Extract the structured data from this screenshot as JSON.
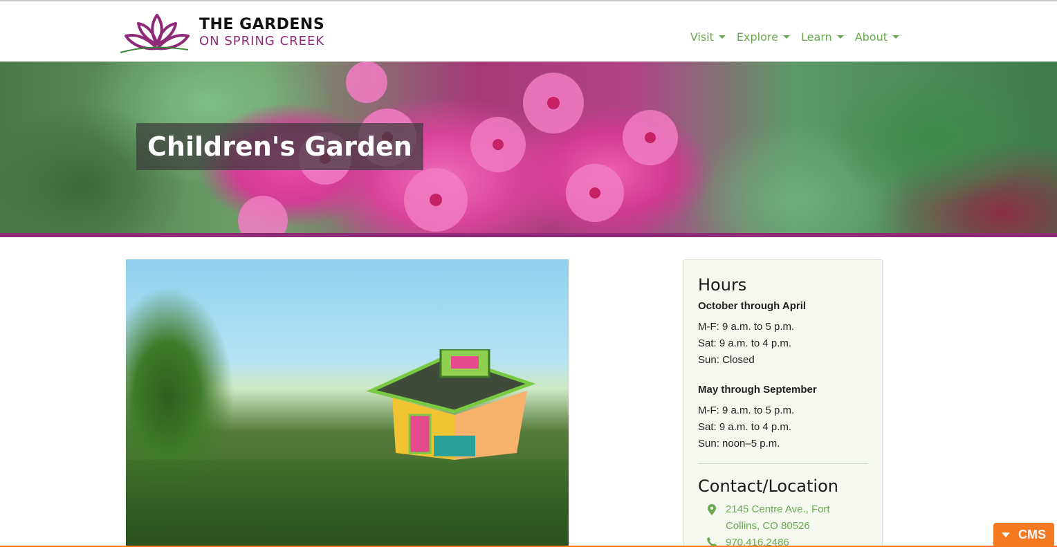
{
  "header": {
    "logo_line1": "THE GARDENS",
    "logo_line2": "ON SPRING CREEK",
    "nav": [
      "Visit",
      "Explore",
      "Learn",
      "About"
    ]
  },
  "hero": {
    "title": "Children's Garden"
  },
  "sidebar": {
    "hours_title": "Hours",
    "season1": {
      "title": "October through April",
      "lines": [
        "M-F: 9 a.m. to 5 p.m.",
        "Sat: 9 a.m. to 4 p.m.",
        "Sun: Closed"
      ]
    },
    "season2": {
      "title": "May through September",
      "lines": [
        "M-F: 9 a.m. to 5 p.m.",
        "Sat: 9 a.m. to 4 p.m.",
        "Sun: noon–5 p.m."
      ]
    },
    "contact_title": "Contact/Location",
    "address_line1": "2145 Centre Ave., Fort",
    "address_line2": "Collins, CO 80526",
    "phone": "970.416.2486"
  },
  "cms": {
    "label": "CMS"
  },
  "colors": {
    "brand_purple": "#8e2a78",
    "nav_green": "#6aa84f",
    "cms_orange": "#f47920"
  }
}
